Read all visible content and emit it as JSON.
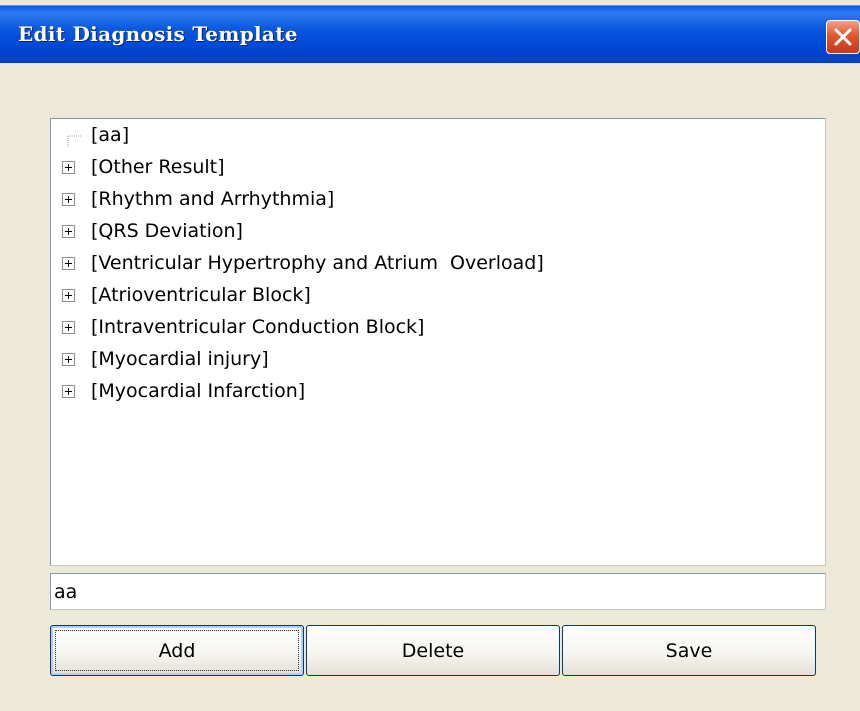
{
  "window": {
    "title": "Edit Diagnosis Template"
  },
  "tree": {
    "items": [
      {
        "label": "[aa]",
        "expandable": false
      },
      {
        "label": "[Other Result]",
        "expandable": true
      },
      {
        "label": "[Rhythm and Arrhythmia]",
        "expandable": true
      },
      {
        "label": "[QRS Deviation]",
        "expandable": true
      },
      {
        "label": "[Ventricular Hypertrophy and Atrium  Overload]",
        "expandable": true
      },
      {
        "label": "[Atrioventricular Block]",
        "expandable": true
      },
      {
        "label": "[Intraventricular Conduction Block]",
        "expandable": true
      },
      {
        "label": "[Myocardial injury]",
        "expandable": true
      },
      {
        "label": "[Myocardial Infarction]",
        "expandable": true
      }
    ]
  },
  "name_input": {
    "value": "aa"
  },
  "buttons": {
    "add_label": "Add",
    "delete_label": "Delete",
    "save_label": "Save"
  },
  "icons": {
    "close": "close-icon",
    "expander": "plus-box-icon"
  },
  "colors": {
    "titlebar": "#0054e3",
    "window_face": "#ece9d8",
    "close_button": "#e0582f",
    "button_border": "#003c74"
  }
}
